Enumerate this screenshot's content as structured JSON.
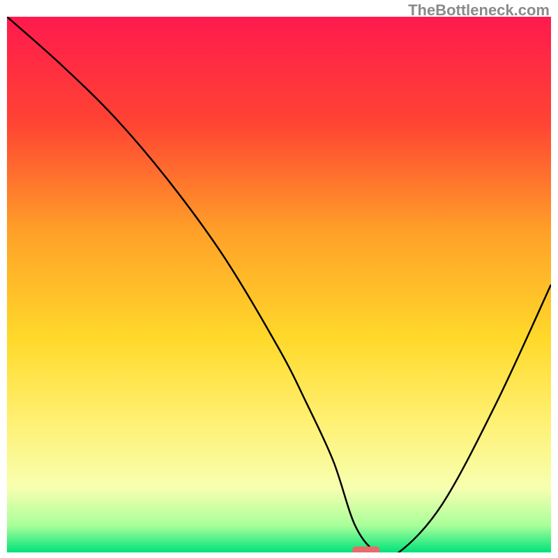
{
  "watermark": "TheBottleneck.com",
  "chart_data": {
    "type": "line",
    "title": "",
    "xlabel": "",
    "ylabel": "",
    "xlim": [
      0,
      100
    ],
    "ylim": [
      0,
      100
    ],
    "grid": false,
    "axes_visible": false,
    "background": "rainbow-gradient-red-to-green",
    "gradient_stops": [
      {
        "offset": 0,
        "color": "#ff1a4d"
      },
      {
        "offset": 20,
        "color": "#ff4433"
      },
      {
        "offset": 40,
        "color": "#ffa028"
      },
      {
        "offset": 60,
        "color": "#ffd92a"
      },
      {
        "offset": 75,
        "color": "#fff070"
      },
      {
        "offset": 88,
        "color": "#f7ffb0"
      },
      {
        "offset": 95,
        "color": "#a8ff9a"
      },
      {
        "offset": 100,
        "color": "#00e27a"
      }
    ],
    "series": [
      {
        "name": "bottleneck-curve",
        "color": "#000000",
        "x": [
          0,
          10,
          20,
          30,
          40,
          50,
          55,
          60,
          64,
          68,
          72,
          80,
          90,
          100
        ],
        "y": [
          100,
          91,
          81,
          69,
          55,
          38,
          28,
          17,
          5,
          0,
          0,
          9,
          28,
          50
        ]
      }
    ],
    "marker": {
      "name": "optimal-point",
      "shape": "rounded-rect",
      "color": "#e86a6a",
      "x": 66,
      "y": 0,
      "width": 5,
      "height": 2.2
    }
  }
}
